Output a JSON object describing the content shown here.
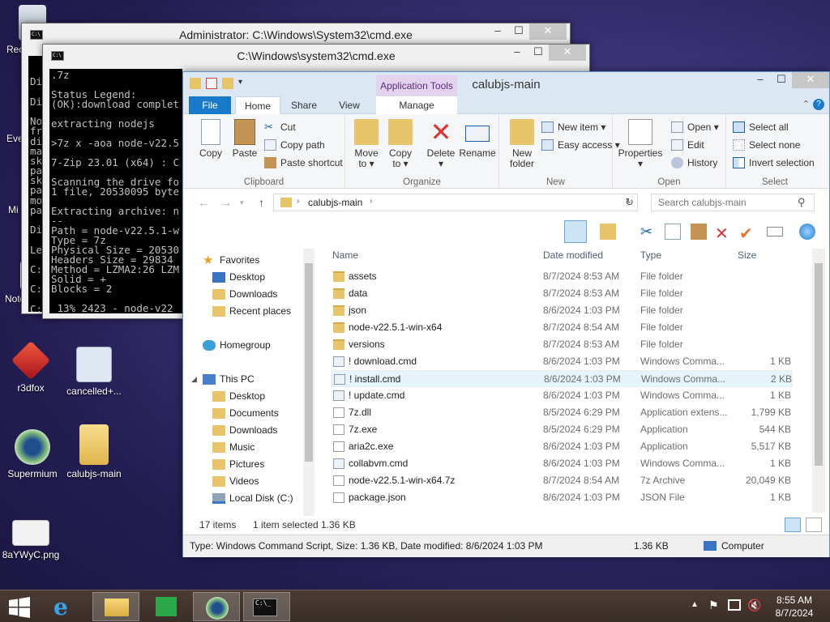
{
  "desktop": {
    "icons": [
      {
        "label": "Rec",
        "name": "desktop-icon-recycle-bin"
      },
      {
        "label": "Eve",
        "name": "desktop-icon-eve"
      },
      {
        "label": "Mi",
        "name": "desktop-icon-mi"
      },
      {
        "label": "Notepac",
        "name": "desktop-icon-notepad"
      },
      {
        "label": "r3dfox",
        "name": "desktop-icon-r3dfox"
      },
      {
        "label": "cancelled+...",
        "name": "desktop-icon-cancelled"
      },
      {
        "label": "Supermium",
        "name": "desktop-icon-supermium"
      },
      {
        "label": "calubjs-main",
        "name": "desktop-icon-calubjs-main"
      },
      {
        "label": "8aYWyC.png",
        "name": "desktop-icon-png"
      }
    ]
  },
  "cmd_back": {
    "title": "Administrator: C:\\Windows\\System32\\cmd.exe",
    "lines": [
      "Di",
      "",
      "Di",
      "",
      "No",
      "fr",
      "di",
      "ma",
      "sk",
      "pa",
      "sk",
      "pa",
      "mo",
      "pa",
      "",
      "Di",
      "",
      "Le",
      "",
      "C:",
      "",
      "C:",
      "",
      "C:",
      "",
      "C:"
    ]
  },
  "cmd_front": {
    "title": "C:\\Windows\\system32\\cmd.exe",
    "text": ".7z\n\nStatus Legend:\n(OK):download complet\n\nextracting nodejs\n\n>7z x -aoa node-v22.5\n\n7-Zip 23.01 (x64) : C\n\nScanning the drive fo\n1 file, 20530095 byte\n\nExtracting archive: n\n--\nPath = node-v22.5.1-w\nType = 7z\nPhysical Size = 20530\nHeaders Size = 29834\nMethod = LZMA2:26 LZM\nSolid = +\nBlocks = 2\n\n 13% 2423 - node-v22"
  },
  "explorer": {
    "title": "calubjs-main",
    "app_tools": "Application Tools",
    "tabs": {
      "file": "File",
      "home": "Home",
      "share": "Share",
      "view": "View",
      "manage": "Manage"
    },
    "ribbon": {
      "copy": "Copy",
      "paste": "Paste",
      "cut": "Cut",
      "copy_path": "Copy path",
      "paste_shortcut": "Paste shortcut",
      "clipboard": "Clipboard",
      "move_to": "Move",
      "move_to2": "to ▾",
      "copy_to": "Copy",
      "copy_to2": "to ▾",
      "delete": "Delete",
      "delete2": "▾",
      "rename": "Rename",
      "organize": "Organize",
      "new_folder": "New",
      "new_folder2": "folder",
      "new_item": "New item ▾",
      "easy_access": "Easy access ▾",
      "new": "New",
      "properties": "Properties",
      "properties2": "▾",
      "open": "Open ▾",
      "edit": "Edit",
      "history": "History",
      "open_group": "Open",
      "select_all": "Select all",
      "select_none": "Select none",
      "invert_selection": "Invert selection",
      "select": "Select"
    },
    "address": {
      "crumb": "calubjs-main",
      "search_placeholder": "Search calubjs-main"
    },
    "nav": {
      "favorites": "Favorites",
      "desktop": "Desktop",
      "downloads": "Downloads",
      "recent": "Recent places",
      "homegroup": "Homegroup",
      "thispc": "This PC",
      "pc_desktop": "Desktop",
      "documents": "Documents",
      "pc_downloads": "Downloads",
      "music": "Music",
      "pictures": "Pictures",
      "videos": "Videos",
      "localdisk": "Local Disk (C:)"
    },
    "columns": {
      "name": "Name",
      "date": "Date modified",
      "type": "Type",
      "size": "Size"
    },
    "files": [
      {
        "name": "assets",
        "date": "8/7/2024 8:53 AM",
        "type": "File folder",
        "size": "",
        "icon": "folder"
      },
      {
        "name": "data",
        "date": "8/7/2024 8:53 AM",
        "type": "File folder",
        "size": "",
        "icon": "folder"
      },
      {
        "name": "json",
        "date": "8/6/2024 1:03 PM",
        "type": "File folder",
        "size": "",
        "icon": "folder"
      },
      {
        "name": "node-v22.5.1-win-x64",
        "date": "8/7/2024 8:54 AM",
        "type": "File folder",
        "size": "",
        "icon": "folder"
      },
      {
        "name": "versions",
        "date": "8/7/2024 8:53 AM",
        "type": "File folder",
        "size": "",
        "icon": "folder"
      },
      {
        "name": "! download.cmd",
        "date": "8/6/2024 1:03 PM",
        "type": "Windows Comma...",
        "size": "1 KB",
        "icon": "cmd"
      },
      {
        "name": "! install.cmd",
        "date": "8/6/2024 1:03 PM",
        "type": "Windows Comma...",
        "size": "2 KB",
        "icon": "cmd"
      },
      {
        "name": "! update.cmd",
        "date": "8/6/2024 1:03 PM",
        "type": "Windows Comma...",
        "size": "1 KB",
        "icon": "cmd"
      },
      {
        "name": "7z.dll",
        "date": "8/5/2024 6:29 PM",
        "type": "Application extens...",
        "size": "1,799 KB",
        "icon": "file"
      },
      {
        "name": "7z.exe",
        "date": "8/5/2024 6:29 PM",
        "type": "Application",
        "size": "544 KB",
        "icon": "file"
      },
      {
        "name": "aria2c.exe",
        "date": "8/6/2024 1:03 PM",
        "type": "Application",
        "size": "5,517 KB",
        "icon": "file"
      },
      {
        "name": "collabvm.cmd",
        "date": "8/6/2024 1:03 PM",
        "type": "Windows Comma...",
        "size": "1 KB",
        "icon": "cmd"
      },
      {
        "name": "node-v22.5.1-win-x64.7z",
        "date": "8/7/2024 8:54 AM",
        "type": "7z Archive",
        "size": "20,049 KB",
        "icon": "file"
      },
      {
        "name": "package.json",
        "date": "8/6/2024 1:03 PM",
        "type": "JSON File",
        "size": "1 KB",
        "icon": "file"
      }
    ],
    "status": {
      "count": "17 items",
      "selected": "1 item selected",
      "selsize": "1.36 KB"
    },
    "details": {
      "info": "Type: Windows Command Script, Size: 1.36 KB, Date modified: 8/6/2024 1:03 PM",
      "size": "1.36 KB",
      "location": "Computer"
    }
  },
  "taskbar": {
    "time": "8:55 AM",
    "date": "8/7/2024"
  }
}
